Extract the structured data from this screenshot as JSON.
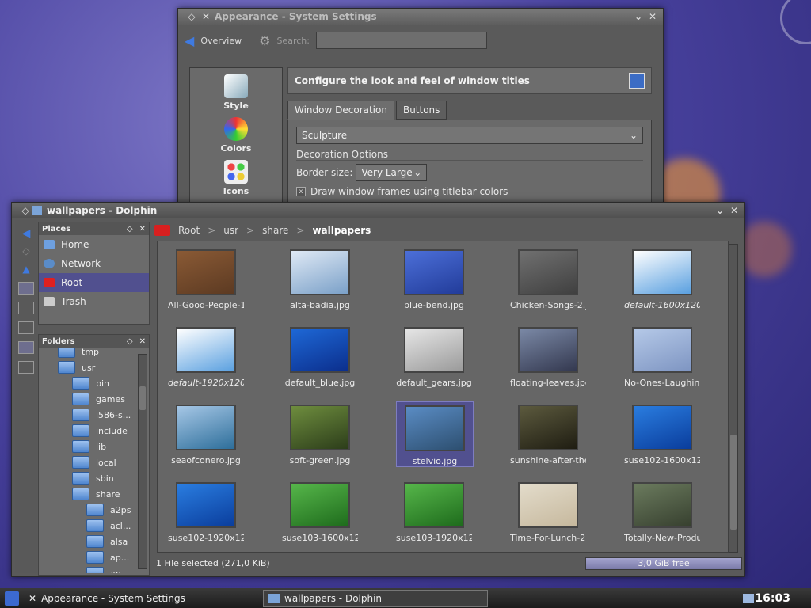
{
  "system_settings": {
    "title": "Appearance - System Settings",
    "overview_label": "Overview",
    "search_label": "Search:",
    "search_value": "",
    "categories": [
      {
        "label": "Style",
        "icon": "style-icon"
      },
      {
        "label": "Colors",
        "icon": "colors-icon"
      },
      {
        "label": "Icons",
        "icon": "icons-icon"
      }
    ],
    "header": "Configure the look and feel of window titles",
    "tabs": [
      "Window Decoration",
      "Buttons"
    ],
    "decoration_value": "Sculpture",
    "decoration_options_label": "Decoration Options",
    "border_size_label": "Border size:",
    "border_size_value": "Very Large",
    "draw_frames_label": "Draw window frames using titlebar colors"
  },
  "dolphin": {
    "title": "wallpapers - Dolphin",
    "places_title": "Places",
    "places": [
      {
        "label": "Home",
        "selected": false
      },
      {
        "label": "Network",
        "selected": false
      },
      {
        "label": "Root",
        "selected": true
      },
      {
        "label": "Trash",
        "selected": false
      }
    ],
    "folders_title": "Folders",
    "folder_tree": [
      {
        "label": "tmp",
        "depth": 1
      },
      {
        "label": "usr",
        "depth": 1
      },
      {
        "label": "bin",
        "depth": 2
      },
      {
        "label": "games",
        "depth": 2
      },
      {
        "label": "i586-s...",
        "depth": 2
      },
      {
        "label": "include",
        "depth": 2
      },
      {
        "label": "lib",
        "depth": 2
      },
      {
        "label": "local",
        "depth": 2
      },
      {
        "label": "sbin",
        "depth": 2
      },
      {
        "label": "share",
        "depth": 2
      },
      {
        "label": "a2ps",
        "depth": 3
      },
      {
        "label": "acl...",
        "depth": 3
      },
      {
        "label": "alsa",
        "depth": 3
      },
      {
        "label": "ap...",
        "depth": 3
      },
      {
        "label": "ap",
        "depth": 3
      }
    ],
    "breadcrumb": [
      "Root",
      "usr",
      "share",
      "wallpapers"
    ],
    "files": [
      {
        "name": "All-Good-People-1...",
        "color1": "#8a5a35",
        "color2": "#5c3a22"
      },
      {
        "name": "alta-badia.jpg",
        "color1": "#dfe9f5",
        "color2": "#7aa0c8"
      },
      {
        "name": "blue-bend.jpg",
        "color1": "#4c6fd8",
        "color2": "#223c9a"
      },
      {
        "name": "Chicken-Songs-2.jpg",
        "color1": "#707070",
        "color2": "#404040"
      },
      {
        "name": "default-1600x1200...",
        "color1": "#ffffff",
        "color2": "#5aa0e0",
        "italic": true
      },
      {
        "name": "default-1920x1200...",
        "color1": "#ffffff",
        "color2": "#5aa0e0",
        "italic": true
      },
      {
        "name": "default_blue.jpg",
        "color1": "#1e68d6",
        "color2": "#0b2e8c"
      },
      {
        "name": "default_gears.jpg",
        "color1": "#e6e6e6",
        "color2": "#9a9a9a"
      },
      {
        "name": "floating-leaves.jpg",
        "color1": "#7b89a6",
        "color2": "#33384f"
      },
      {
        "name": "No-Ones-Laughin...",
        "color1": "#b5c9e8",
        "color2": "#7e95c2"
      },
      {
        "name": "seaofconero.jpg",
        "color1": "#a6c7e6",
        "color2": "#2d6e9a"
      },
      {
        "name": "soft-green.jpg",
        "color1": "#6e8d3e",
        "color2": "#2c3d1a"
      },
      {
        "name": "stelvio.jpg",
        "color1": "#5a8cc4",
        "color2": "#2d4f70",
        "selected": true
      },
      {
        "name": "sunshine-after-the-...",
        "color1": "#5c5a3e",
        "color2": "#1f1d12"
      },
      {
        "name": "suse102-1600x12...",
        "color1": "#2a7de0",
        "color2": "#0a3d9c"
      },
      {
        "name": "suse102-1920x12...",
        "color1": "#2a7de0",
        "color2": "#0a3d9c"
      },
      {
        "name": "suse103-1600x12...",
        "color1": "#56b64a",
        "color2": "#1e6b1c"
      },
      {
        "name": "suse103-1920x12...",
        "color1": "#56b64a",
        "color2": "#1e6b1c"
      },
      {
        "name": "Time-For-Lunch-2....",
        "color1": "#e3dccb",
        "color2": "#c6b89d"
      },
      {
        "name": "Totally-New-Produ...",
        "color1": "#6b7b5e",
        "color2": "#37402f"
      }
    ],
    "status_text": "1 File selected (271,0 KiB)",
    "free_space": "3,0 GiB free",
    "free_fraction": 0.72
  },
  "taskbar": {
    "items": [
      "Appearance - System Settings",
      "wallpapers - Dolphin"
    ],
    "active_item": 1,
    "clock": "16:03"
  }
}
